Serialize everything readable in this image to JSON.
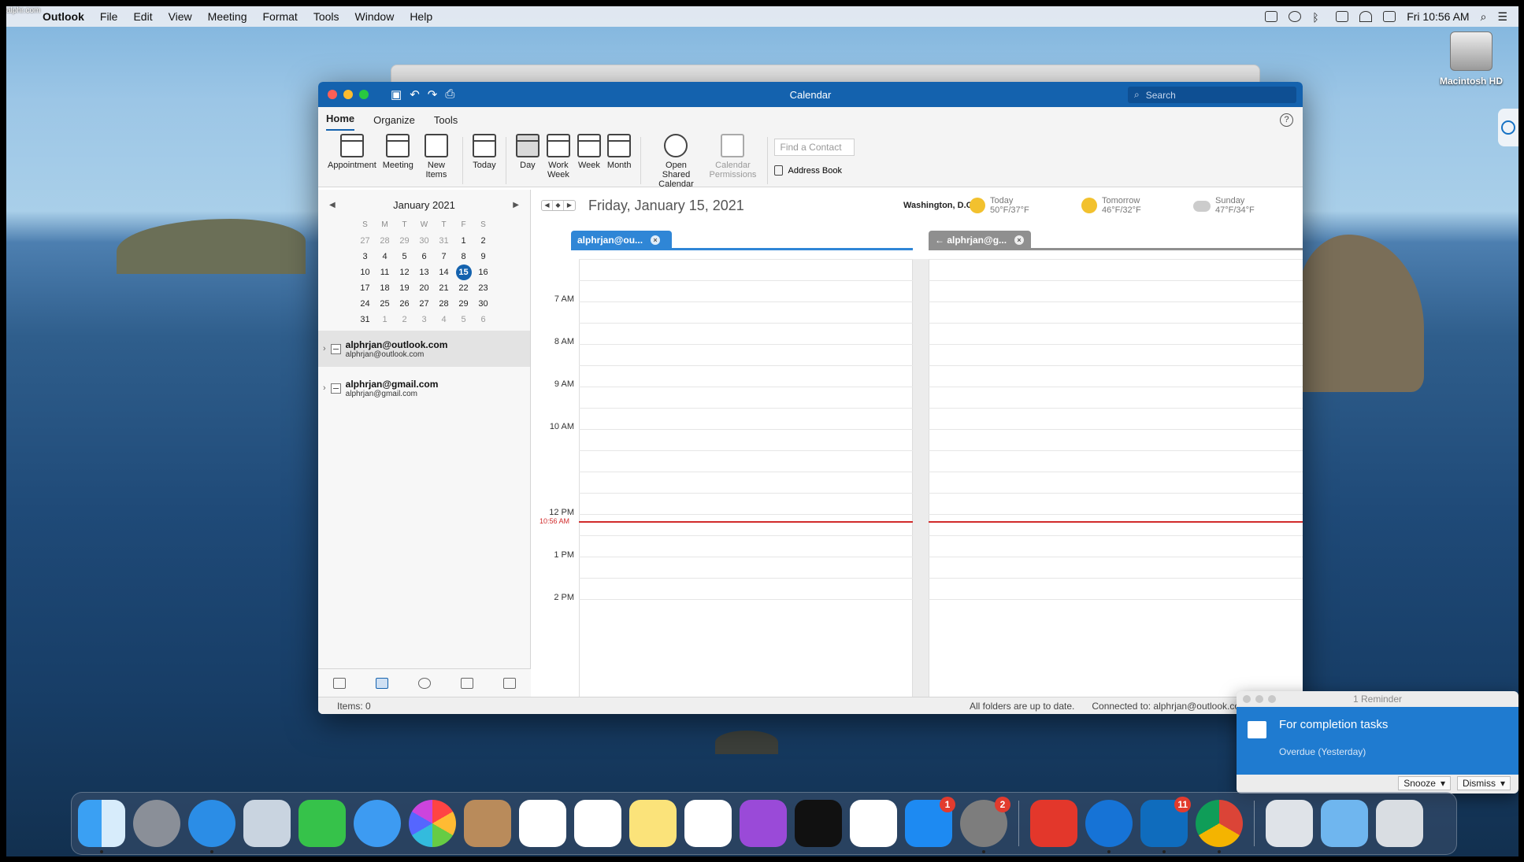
{
  "watermark": "alphr.com",
  "menubar": {
    "app": "Outlook",
    "items": [
      "File",
      "Edit",
      "View",
      "Meeting",
      "Format",
      "Tools",
      "Window",
      "Help"
    ],
    "clock": "Fri 10:56 AM"
  },
  "desktop": {
    "disk_label": "Macintosh HD"
  },
  "window": {
    "title": "Calendar",
    "search_placeholder": "Search",
    "tabs": [
      "Home",
      "Organize",
      "Tools"
    ],
    "ribbon": {
      "appointment": "Appointment",
      "meeting": "Meeting",
      "new_items": "New Items",
      "today": "Today",
      "day": "Day",
      "work_week": "Work Week",
      "week": "Week",
      "month": "Month",
      "open_shared": "Open Shared Calendar",
      "permissions": "Calendar Permissions",
      "find_contact": "Find a Contact",
      "address_book": "Address Book"
    }
  },
  "minical": {
    "month": "January 2021",
    "dow": [
      "S",
      "M",
      "T",
      "W",
      "T",
      "F",
      "S"
    ],
    "weeks": [
      [
        "27",
        "28",
        "29",
        "30",
        "31",
        "1",
        "2"
      ],
      [
        "3",
        "4",
        "5",
        "6",
        "7",
        "8",
        "9"
      ],
      [
        "10",
        "11",
        "12",
        "13",
        "14",
        "15",
        "16"
      ],
      [
        "17",
        "18",
        "19",
        "20",
        "21",
        "22",
        "23"
      ],
      [
        "24",
        "25",
        "26",
        "27",
        "28",
        "29",
        "30"
      ],
      [
        "31",
        "1",
        "2",
        "3",
        "4",
        "5",
        "6"
      ]
    ],
    "today": "15"
  },
  "accounts": [
    {
      "name": "alphrjan@outlook.com",
      "sub": "alphrjan@outlook.com"
    },
    {
      "name": "alphrjan@gmail.com",
      "sub": "alphrjan@gmail.com"
    }
  ],
  "calendar": {
    "date": "Friday, January 15, 2021",
    "location": "Washington, D.C.",
    "weather": [
      {
        "label": "Today",
        "temp": "50°F/37°F"
      },
      {
        "label": "Tomorrow",
        "temp": "46°F/32°F"
      },
      {
        "label": "Sunday",
        "temp": "47°F/34°F"
      }
    ],
    "tab1": "alphrjan@ou...",
    "tab2": "alphrjan@g...",
    "hours": [
      "7 AM",
      "8 AM",
      "9 AM",
      "10 AM",
      "12 PM",
      "1 PM",
      "2 PM"
    ],
    "now": "10:56 AM"
  },
  "status": {
    "items": "Items: 0",
    "sync": "All folders are up to date.",
    "connected": "Connected to: alphrjan@outlook.com"
  },
  "reminder": {
    "title": "1 Reminder",
    "subject": "For completion tasks",
    "due": "Overdue (Yesterday)",
    "snooze": "Snooze",
    "dismiss": "Dismiss"
  },
  "dock": {
    "badges": {
      "appstore": "1",
      "prefs": "2",
      "outlook": "11"
    }
  },
  "colors": {
    "accent": "#1462ae",
    "now_line": "#d12b2b",
    "reminder_bg": "#1f7bd0"
  }
}
